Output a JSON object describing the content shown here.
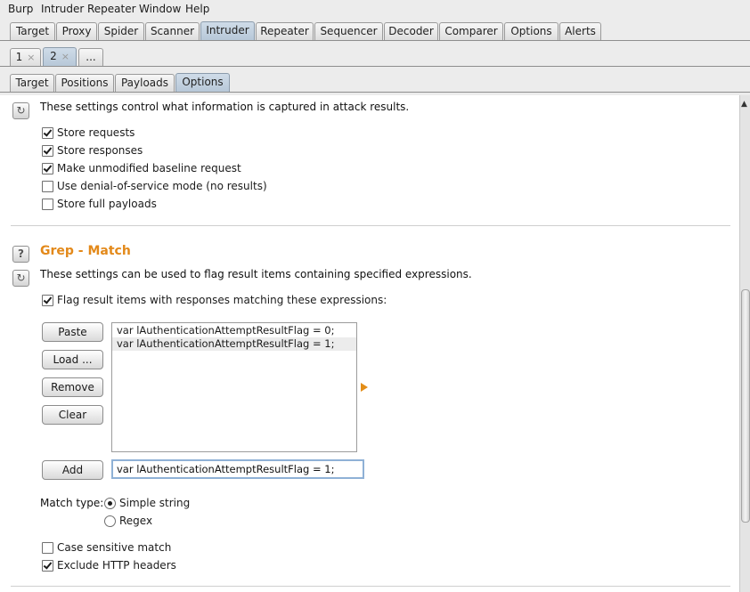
{
  "menubar": [
    "Burp",
    "Intruder",
    "Repeater",
    "Window",
    "Help"
  ],
  "main_tabs": [
    "Target",
    "Proxy",
    "Spider",
    "Scanner",
    "Intruder",
    "Repeater",
    "Sequencer",
    "Decoder",
    "Comparer",
    "Options",
    "Alerts"
  ],
  "main_tabs_active": "Intruder",
  "attack_tabs": [
    {
      "label": "1",
      "close": "×"
    },
    {
      "label": "2",
      "close": "×"
    },
    {
      "label": "...",
      "close": ""
    }
  ],
  "attack_tabs_active": "2",
  "sub_tabs": [
    "Target",
    "Positions",
    "Payloads",
    "Options"
  ],
  "sub_tabs_active": "Options",
  "attack_results": {
    "description": "These settings control what information is captured in attack results.",
    "options": [
      {
        "label": "Store requests",
        "checked": true
      },
      {
        "label": "Store responses",
        "checked": true
      },
      {
        "label": "Make unmodified baseline request",
        "checked": true
      },
      {
        "label": "Use denial-of-service mode (no results)",
        "checked": false
      },
      {
        "label": "Store full payloads",
        "checked": false
      }
    ]
  },
  "grep_match": {
    "title": "Grep - Match",
    "help_icon": "?",
    "description": "These settings can be used to flag result items containing specified expressions.",
    "flag_option": {
      "label": "Flag result items with responses matching these expressions:",
      "checked": true
    },
    "buttons": {
      "paste": "Paste",
      "load": "Load ...",
      "remove": "Remove",
      "clear": "Clear",
      "add": "Add"
    },
    "expressions": [
      "var lAuthenticationAttemptResultFlag = 0;",
      "var lAuthenticationAttemptResultFlag = 1;"
    ],
    "new_expression": "var lAuthenticationAttemptResultFlag = 1;",
    "match_type_label": "Match type:",
    "match_types": [
      {
        "label": "Simple string",
        "selected": true
      },
      {
        "label": "Regex",
        "selected": false
      }
    ],
    "case_sensitive": {
      "label": "Case sensitive match",
      "checked": false
    },
    "exclude_headers": {
      "label": "Exclude HTTP headers",
      "checked": true
    }
  },
  "colors": {
    "section_title": "#e3891a",
    "active_tab": "#b7c8d8",
    "input_focus": "#8fb1d6"
  }
}
